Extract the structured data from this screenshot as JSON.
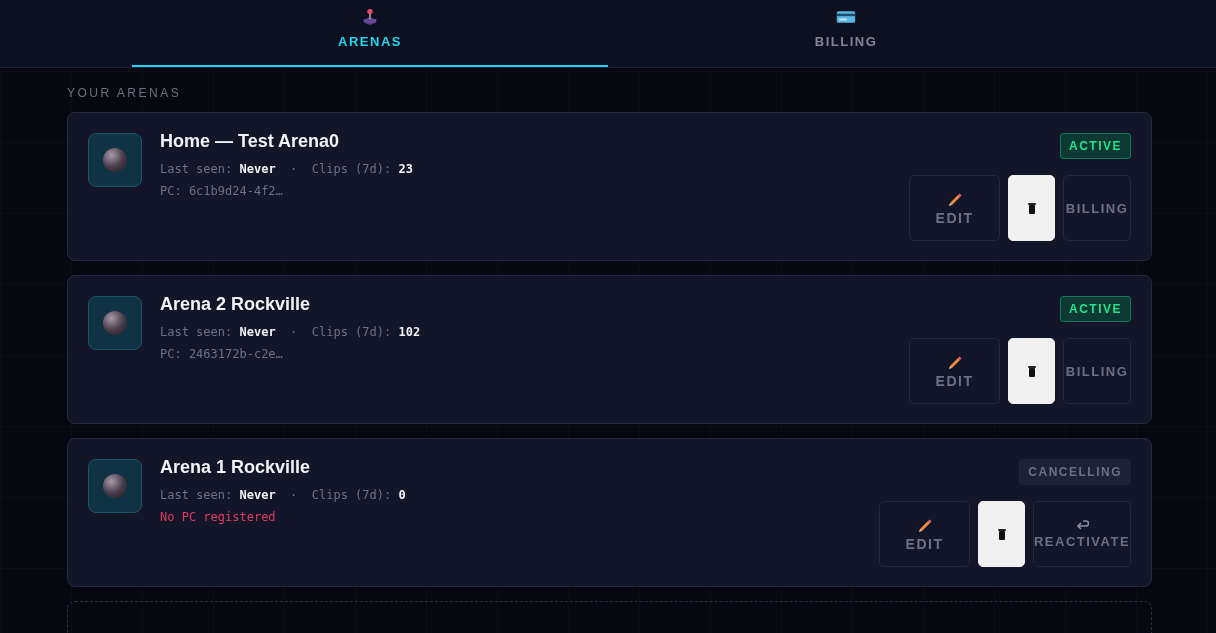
{
  "tabs": [
    {
      "label": "ARENAS",
      "kind": "arenas",
      "selected": true
    },
    {
      "label": "BILLING",
      "kind": "billing",
      "selected": false
    }
  ],
  "section_label": "YOUR ARENAS",
  "arenas": [
    {
      "name": "Home — Test Arena0",
      "last_seen_label": "Last seen:",
      "last_seen": "Never",
      "separator": "·",
      "clips_label": "Clips (7d):",
      "clips": "23",
      "pc": "PC: 6c1b9d24-4f2…",
      "pc_missing": false,
      "status": {
        "kind": "active",
        "label": "ACTIVE"
      },
      "actions": [
        {
          "kind": "edit",
          "label": "EDIT"
        },
        {
          "kind": "delete"
        },
        {
          "kind": "billing",
          "label": "BILLING"
        }
      ]
    },
    {
      "name": "Arena 2 Rockville",
      "last_seen_label": "Last seen:",
      "last_seen": "Never",
      "separator": "·",
      "clips_label": "Clips (7d):",
      "clips": "102",
      "pc": "PC: 2463172b-c2e…",
      "pc_missing": false,
      "status": {
        "kind": "active",
        "label": "ACTIVE"
      },
      "actions": [
        {
          "kind": "edit",
          "label": "EDIT"
        },
        {
          "kind": "delete"
        },
        {
          "kind": "billing",
          "label": "BILLING"
        }
      ]
    },
    {
      "name": "Arena 1 Rockville",
      "last_seen_label": "Last seen:",
      "last_seen": "Never",
      "separator": "·",
      "clips_label": "Clips (7d):",
      "clips": "0",
      "pc": "No PC registered",
      "pc_missing": true,
      "status": {
        "kind": "cancelling",
        "label": "CANCELLING"
      },
      "actions": [
        {
          "kind": "edit",
          "label": "EDIT"
        },
        {
          "kind": "delete"
        },
        {
          "kind": "reactivate",
          "label": "REACTIVATE"
        }
      ]
    }
  ]
}
